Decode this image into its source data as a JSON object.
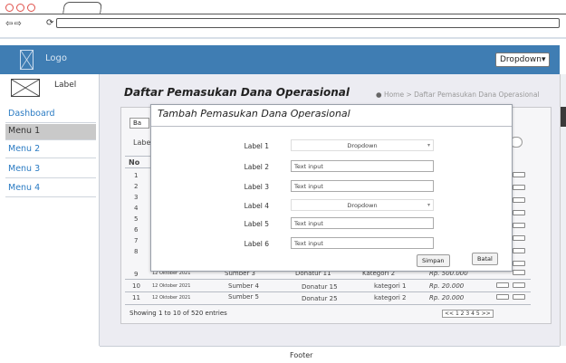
{
  "header": {
    "logo_label": "Logo",
    "dropdown_label": "Dropdown"
  },
  "sidebar": {
    "label": "Label",
    "items": [
      {
        "label": "Dashboard"
      },
      {
        "label": "Menu 1"
      },
      {
        "label": "Menu 2"
      },
      {
        "label": "Menu 3"
      },
      {
        "label": "Menu 4"
      }
    ]
  },
  "page": {
    "title": "Daftar Pemasukan Dana Operasional",
    "breadcrumb_home": "Home",
    "breadcrumb_current": "Daftar Pemasukan Dana Operasional"
  },
  "table": {
    "filter_label": "Label",
    "add_button": "Ba",
    "no_header": "No",
    "row_numbers": [
      "1",
      "2",
      "3",
      "4",
      "5",
      "6",
      "7",
      "8"
    ],
    "visible_rows": [
      {
        "no": "9",
        "date": "12 Oktober 2021",
        "source": "Sumber 3",
        "donor": "Donatur 11",
        "category": "Kategori 2",
        "amount": "Rp. 500.000"
      },
      {
        "no": "10",
        "date": "12 Oktober 2021",
        "source": "Sumber 4",
        "donor": "Donatur 15",
        "category": "kategori 1",
        "amount": "Rp. 20.000"
      },
      {
        "no": "11",
        "date": "12 Oktober 2021",
        "source": "Sumber 5",
        "donor": "Donatur 25",
        "category": "kategori 2",
        "amount": "Rp. 20.000"
      }
    ],
    "info": "Showing 1 to 10 of 520 entries",
    "pagination": "<< 1 2 3 4 5 >>"
  },
  "modal": {
    "title": "Tambah Pemasukan Dana Operasional",
    "fields": [
      {
        "label": "Label 1",
        "type": "select",
        "value": "Dropdown"
      },
      {
        "label": "Label 2",
        "type": "input",
        "value": "Text input"
      },
      {
        "label": "Label 3",
        "type": "input",
        "value": "Text input"
      },
      {
        "label": "Label 4",
        "type": "select",
        "value": "Dropdown"
      },
      {
        "label": "Label 5",
        "type": "input",
        "value": "Text input"
      },
      {
        "label": "Label 6",
        "type": "input",
        "value": "Text input"
      }
    ],
    "save_label": "Simpan",
    "cancel_label": "Batal"
  },
  "footer": {
    "text": "Footer"
  },
  "colors": {
    "header": "#3f7db3",
    "link": "#2a7bc3",
    "active_menu": "#c9c9c9"
  },
  "icons": [
    "back-icon",
    "forward-icon",
    "refresh-icon",
    "home-icon",
    "logo-placeholder-icon",
    "avatar-placeholder-icon",
    "chevron-down-icon"
  ]
}
